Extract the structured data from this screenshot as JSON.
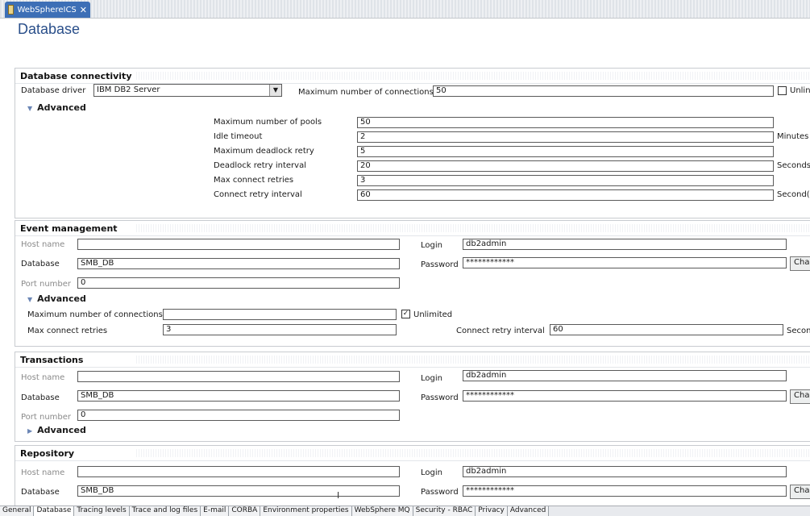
{
  "tab": {
    "label": "WebSphereICS",
    "close": "✕"
  },
  "page_title": "Database",
  "db_connectivity": {
    "header": "Database connectivity",
    "driver_label": "Database driver",
    "driver_value": "IBM DB2 Server",
    "max_conn_label": "Maximum number of connections",
    "max_conn_value": "50",
    "unlimited_label": "Unlin",
    "advanced_label": "Advanced",
    "advanced": [
      {
        "label": "Maximum number of pools",
        "value": "50",
        "unit": ""
      },
      {
        "label": "Idle timeout",
        "value": "2",
        "unit": "Minutes"
      },
      {
        "label": "Maximum deadlock retry",
        "value": "5",
        "unit": ""
      },
      {
        "label": "Deadlock retry interval",
        "value": "20",
        "unit": "Seconds"
      },
      {
        "label": "Max connect retries",
        "value": "3",
        "unit": ""
      },
      {
        "label": "Connect retry interval",
        "value": "60",
        "unit": "Second("
      }
    ]
  },
  "event_mgmt": {
    "header": "Event management",
    "host_label": "Host name",
    "host_value": "",
    "db_label": "Database",
    "db_value": "SMB_DB",
    "port_label": "Port number",
    "port_value": "0",
    "login_label": "Login",
    "login_value": "db2admin",
    "password_label": "Password",
    "password_value": "************",
    "change_label": "Cha",
    "advanced_label": "Advanced",
    "max_conn_label": "Maximum number of connections",
    "max_conn_value": "",
    "unlimited_label": "Unlimited",
    "max_retries_label": "Max connect retries",
    "max_retries_value": "3",
    "retry_interval_label": "Connect retry interval",
    "retry_interval_value": "60",
    "retry_unit": "Secon"
  },
  "transactions": {
    "header": "Transactions",
    "host_label": "Host name",
    "host_value": "",
    "db_label": "Database",
    "db_value": "SMB_DB",
    "port_label": "Port number",
    "port_value": "0",
    "login_label": "Login",
    "login_value": "db2admin",
    "password_label": "Password",
    "password_value": "************",
    "change_label": "Cha",
    "advanced_label": "Advanced"
  },
  "repository": {
    "header": "Repository",
    "host_label": "Host name",
    "host_value": "",
    "db_label": "Database",
    "db_value": "SMB_DB",
    "login_label": "Login",
    "login_value": "db2admin",
    "password_label": "Password",
    "password_value": "************",
    "change_label": "Cha"
  },
  "bottom_tabs": [
    "General",
    "Database",
    "Tracing levels",
    "Trace and log files",
    "E-mail",
    "CORBA",
    "Environment properties",
    "WebSphere MQ",
    "Security - RBAC",
    "Privacy",
    "Advanced"
  ],
  "colors": {
    "tab_bg": "#3d6fb6",
    "title": "#2a4f8a"
  }
}
